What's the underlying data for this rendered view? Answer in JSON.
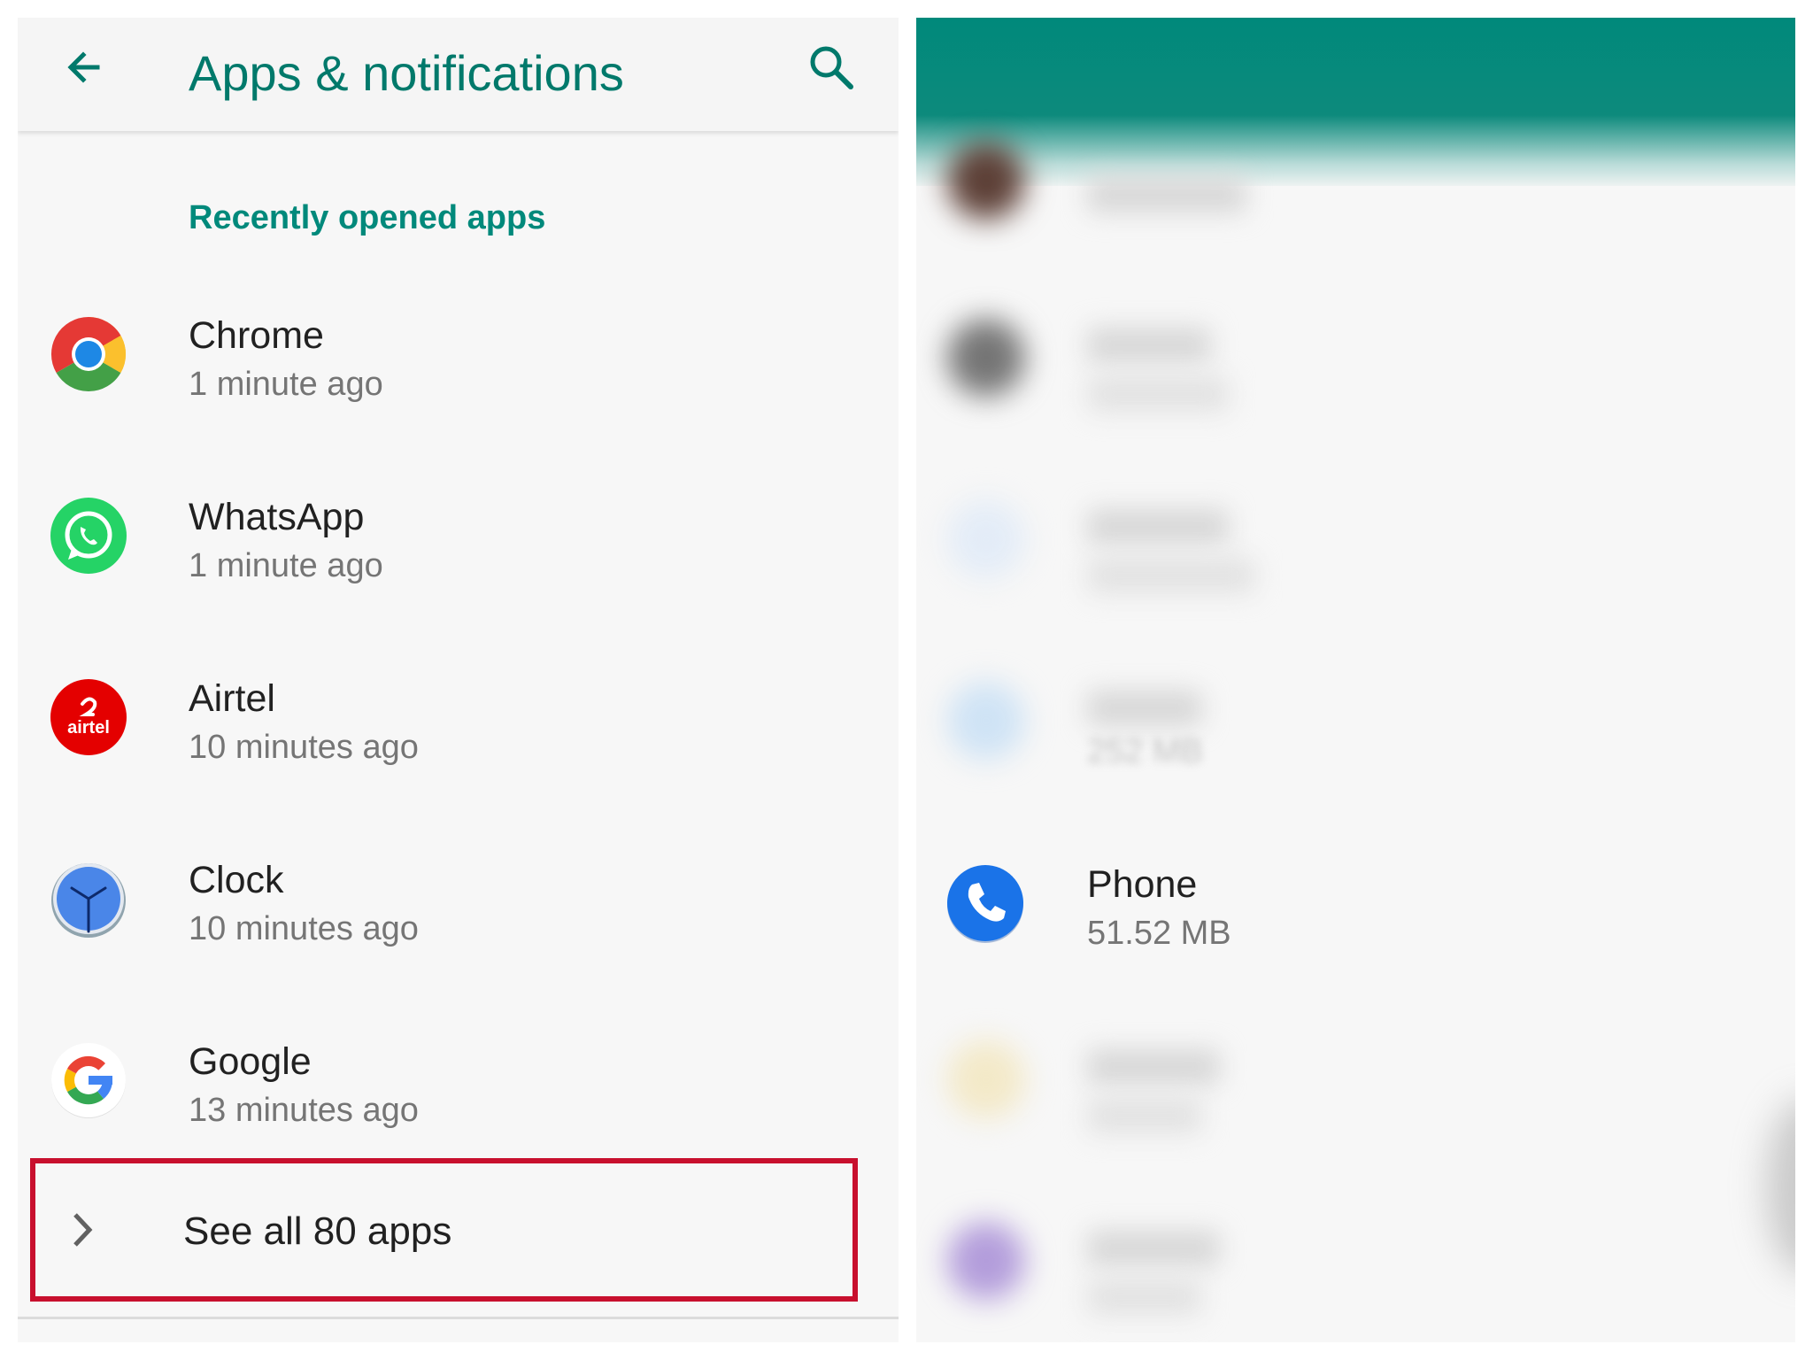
{
  "left_panel": {
    "appbar": {
      "title": "Apps & notifications",
      "back_icon": "arrow-back-icon",
      "search_icon": "search-icon"
    },
    "section_header": "Recently opened apps",
    "recent_apps": [
      {
        "name": "Chrome",
        "time": "1 minute ago",
        "icon": "chrome-icon"
      },
      {
        "name": "WhatsApp",
        "time": "1 minute ago",
        "icon": "whatsapp-icon"
      },
      {
        "name": "Airtel",
        "time": "10 minutes ago",
        "icon": "airtel-icon",
        "icon_text": "airtel"
      },
      {
        "name": "Clock",
        "time": "10 minutes ago",
        "icon": "clock-icon"
      },
      {
        "name": "Google",
        "time": "13 minutes ago",
        "icon": "google-icon"
      }
    ],
    "see_all": {
      "label": "See all 80 apps",
      "icon": "chevron-right-icon"
    }
  },
  "right_panel": {
    "blurred_size_text": "252 MB",
    "phone_app": {
      "name": "Phone",
      "size": "51.52 MB",
      "icon": "phone-icon"
    }
  },
  "colors": {
    "accent_teal": "#00796b",
    "header_teal": "#00897b",
    "highlight_red": "#c8102e"
  }
}
